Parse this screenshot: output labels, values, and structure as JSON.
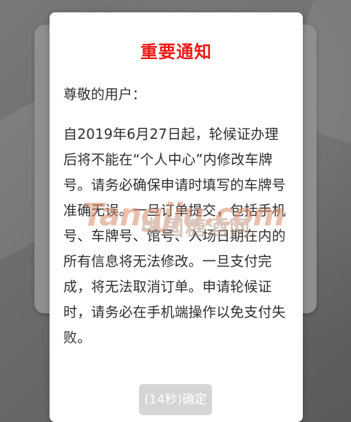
{
  "dialog": {
    "title": "重要通知",
    "greeting": "尊敬的用户：",
    "message": "自2019年6月27日起，轮候证办理后将不能在“个人中心”内修改车牌号。请务必确保申请时填写的车牌号准确无误。一旦订单提交，包括手机号、车牌号、馆号、入场日期在内的所有信息将无法修改。一旦支付完成，将无法取消订单。申请轮候证时，请务必在手机端操作以免支付失败。",
    "button": {
      "countdown": "(14秒)",
      "label": "确定"
    }
  },
  "watermark": {
    "latin": "Tangjiu.com",
    "chinese": "中国糖酒网"
  },
  "colors": {
    "title": "#ee1a1a",
    "button_disabled": "#d5d5d5",
    "overlay": "#6a6a6a"
  }
}
